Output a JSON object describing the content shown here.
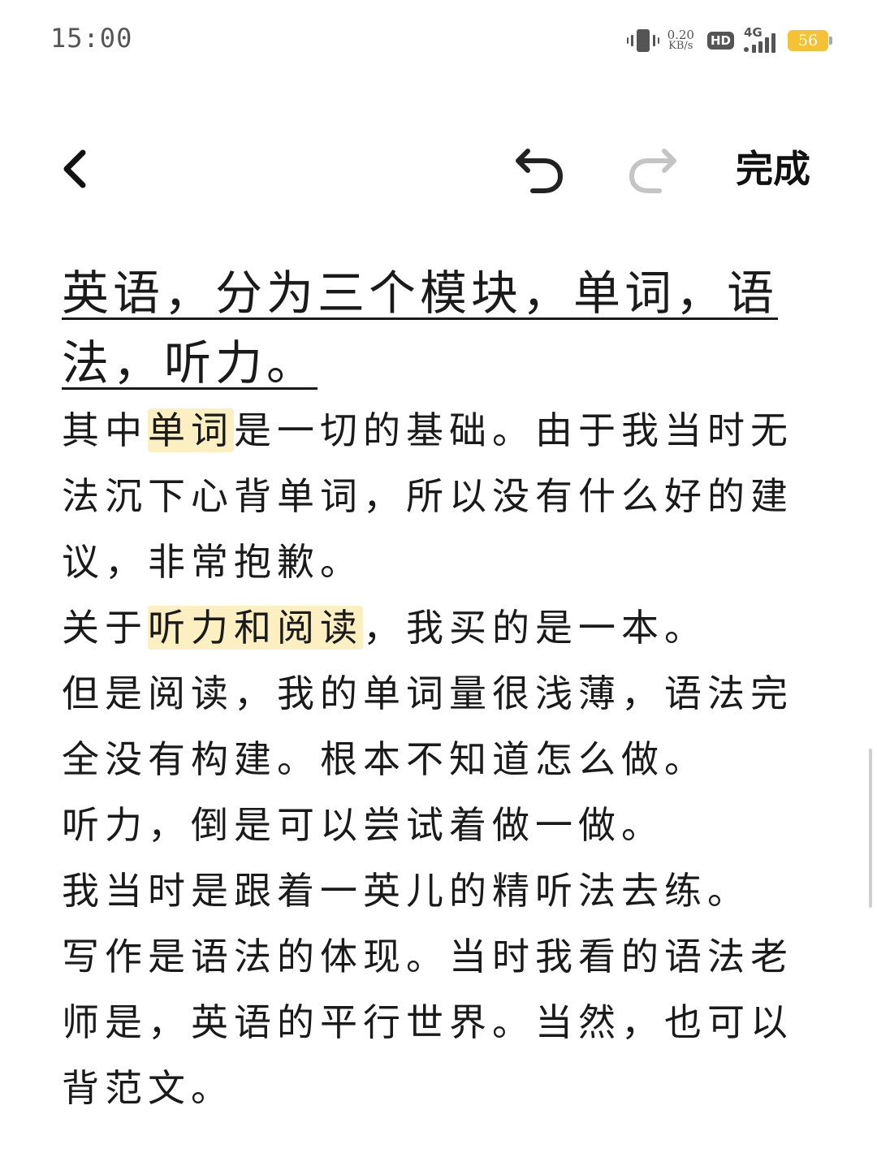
{
  "status_bar": {
    "time": "15:00",
    "net_speed_value": "0.20",
    "net_speed_unit": "KB/s",
    "hd_label": "HD",
    "network_label": "4G",
    "battery_level": "56",
    "battery_color": "#f5c236"
  },
  "toolbar": {
    "back_icon": "chevron-left-icon",
    "undo_icon": "undo-icon",
    "redo_icon": "redo-icon",
    "redo_enabled": false,
    "done_label": "完成"
  },
  "note": {
    "heading": "英语，分为三个模块，单词，语法，听力。",
    "p1": {
      "before": "其中",
      "highlight": "单词",
      "after": "是一切的基础。由于我当时无法沉下心背单词，所以没有什么好的建议，非常抱歉。"
    },
    "p2": {
      "before": "关于",
      "highlight": "听力和阅读",
      "after": "，我买的是一本。"
    },
    "p3": "但是阅读，我的单词量很浅薄，语法完全没有构建。根本不知道怎么做。",
    "p4": "听力，倒是可以尝试着做一做。",
    "p5": "我当时是跟着一英儿的精听法去练。",
    "p6": "写作是语法的体现。当时我看的语法老师是，英语的平行世界。当然，也可以背范文。",
    "highlight_color": "#fcefc2"
  }
}
